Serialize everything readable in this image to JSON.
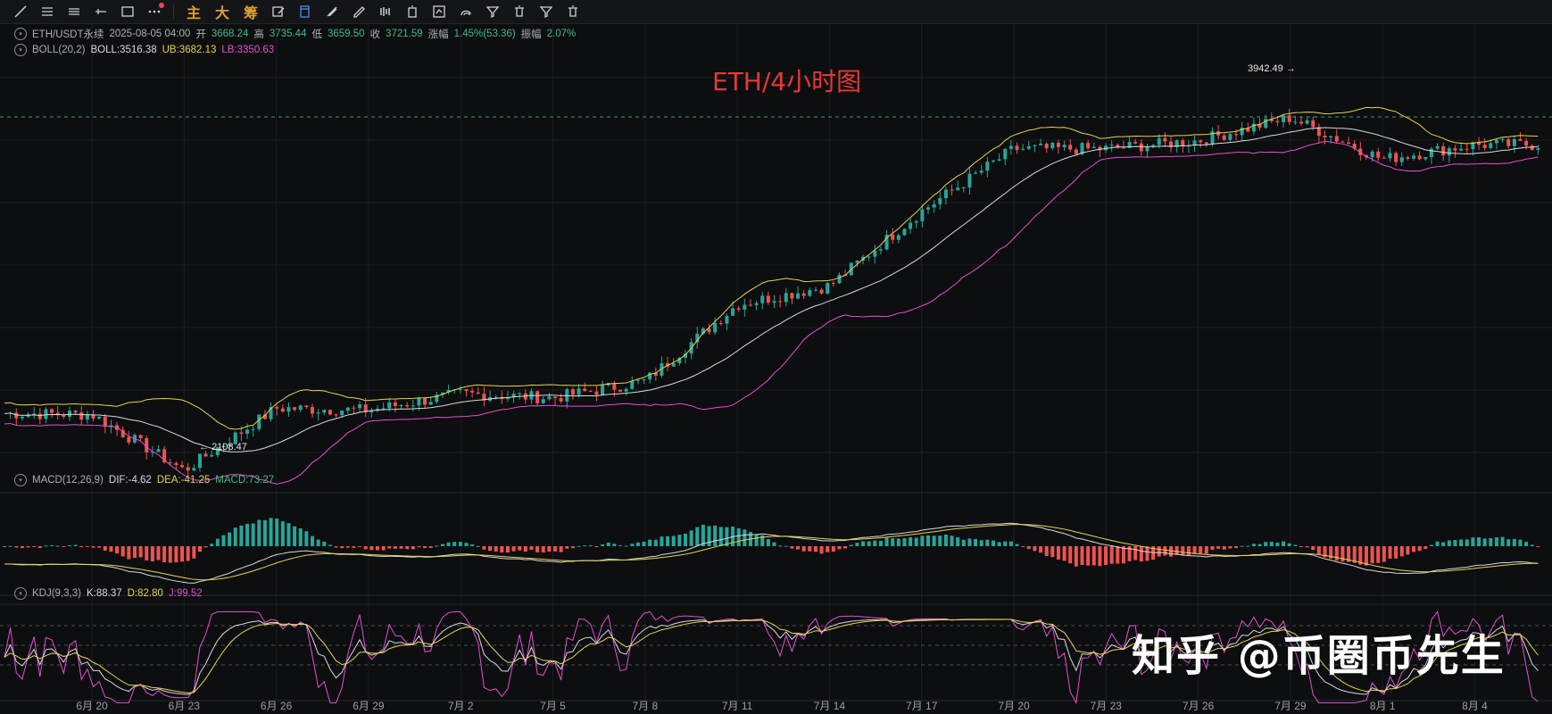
{
  "toolbar": {
    "tools": [
      {
        "name": "trendline-icon"
      },
      {
        "name": "horizontal-lines-icon"
      },
      {
        "name": "parallel-channel-icon"
      },
      {
        "name": "horizontal-ray-icon"
      },
      {
        "name": "rectangle-icon"
      },
      {
        "name": "more-dots-icon"
      }
    ],
    "text_buttons": [
      "主",
      "大",
      "筹"
    ],
    "tools2": [
      {
        "name": "draw-edit-icon"
      },
      {
        "name": "eye-icon"
      },
      {
        "name": "lock-icon"
      },
      {
        "name": "copy-layer-icon"
      },
      {
        "name": "ruler-icon"
      },
      {
        "name": "pencil-icon"
      },
      {
        "name": "candles-icon"
      },
      {
        "name": "alert-icon"
      },
      {
        "name": "calendar-icon"
      },
      {
        "name": "magnet-icon"
      },
      {
        "name": "filter-icon"
      },
      {
        "name": "trash-icon"
      }
    ],
    "accent": "#e0a030"
  },
  "legend": {
    "symbol": "ETH/USDT永续",
    "datetime": "2025-08-05 04:00",
    "open_label": "开",
    "open": "3668.24",
    "high_label": "高",
    "high": "3735.44",
    "low_label": "低",
    "low": "3659.50",
    "close_label": "收",
    "close": "3721.59",
    "change_label": "涨幅",
    "change": "1.45%(53.36)",
    "amp_label": "振幅",
    "amp": "2.07%"
  },
  "boll": {
    "name": "BOLL(20,2)",
    "boll": "BOLL:3516.38",
    "ub": "UB:3682.13",
    "lb": "LB:3350.63"
  },
  "macd": {
    "name": "MACD(12,26,9)",
    "dif": "DIF:-4.62",
    "dea": "DEA:-41.25",
    "macd": "MACD:73.27"
  },
  "kdj": {
    "name": "KDJ(9,3,3)",
    "k": "K:88.37",
    "d": "D:82.80",
    "j": "J:99.52"
  },
  "annotations": {
    "high_mark": "3942.49",
    "low_mark": "2108.47",
    "title": "ETH/4小时图",
    "watermark": "知乎 @币圈币先生"
  },
  "xaxis": [
    "6月 20",
    "6月 23",
    "6月 26",
    "6月 29",
    "7月 2",
    "7月 5",
    "7月 8",
    "7月 11",
    "7月 14",
    "7月 17",
    "7月 20",
    "7月 23",
    "7月 26",
    "7月 29",
    "8月 1",
    "8月 4"
  ],
  "chart_data": {
    "type": "candlestick",
    "interval": "4h",
    "price_markers": {
      "high": 3942.49,
      "low": 2108.47
    },
    "key_closes": [
      {
        "date": "6月 20",
        "price": 2420
      },
      {
        "date": "6月 23",
        "price": 2150
      },
      {
        "date": "6月 26",
        "price": 2450
      },
      {
        "date": "6月 29",
        "price": 2440
      },
      {
        "date": "7月 2",
        "price": 2520
      },
      {
        "date": "7月 5",
        "price": 2500
      },
      {
        "date": "7月 8",
        "price": 2580
      },
      {
        "date": "7月 11",
        "price": 2950
      },
      {
        "date": "7月 14",
        "price": 3040
      },
      {
        "date": "7月 17",
        "price": 3400
      },
      {
        "date": "7月 20",
        "price": 3700
      },
      {
        "date": "7月 23",
        "price": 3700
      },
      {
        "date": "7月 26",
        "price": 3740
      },
      {
        "date": "7月 29",
        "price": 3850
      },
      {
        "date": "8月 1",
        "price": 3650
      },
      {
        "date": "8月 4",
        "price": 3720
      }
    ],
    "colors": {
      "up": "#26a69a",
      "down": "#ef5350",
      "ub": "#e8d44d",
      "lb": "#e54fd0",
      "mid": "#d8dadf"
    }
  }
}
